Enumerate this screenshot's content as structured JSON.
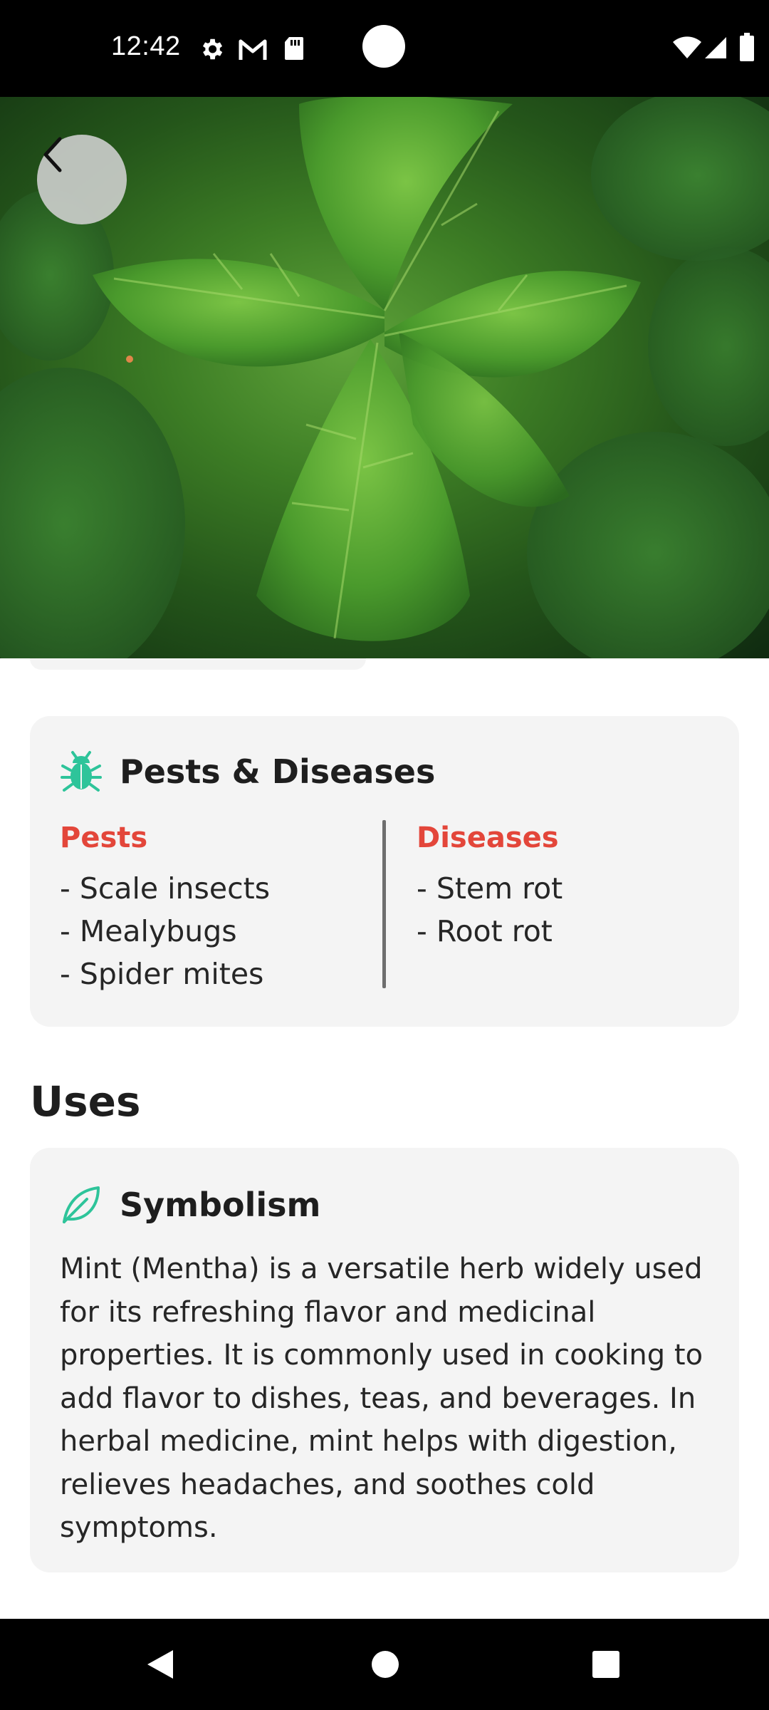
{
  "status_bar": {
    "time": "12:42",
    "icons": [
      "gear-icon",
      "gmail-icon",
      "sd-card-icon",
      "wifi-icon",
      "signal-icon",
      "battery-icon"
    ]
  },
  "hero": {
    "image": "nettle-leaves-photo",
    "back_icon": "chevron-left-icon"
  },
  "pests_card": {
    "icon": "bug-icon",
    "title": "Pests & Diseases",
    "pests_label": "Pests",
    "pests": [
      "- Scale insects",
      "- Mealybugs",
      "- Spider mites"
    ],
    "diseases_label": "Diseases",
    "diseases": [
      "- Stem rot",
      "- Root rot"
    ]
  },
  "uses": {
    "section_title": "Uses",
    "card_icon": "leaf-icon",
    "card_title": "Symbolism",
    "text": "Mint (Mentha) is a versatile herb widely used for its refreshing flavor and medicinal properties. It is commonly used in cooking to add flavor to dishes, teas, and beverages. In herbal medicine, mint helps with digestion, relieves headaches, and soothes cold symptoms."
  },
  "colors": {
    "accent_green": "#2ec49a",
    "label_red": "#e3463a",
    "card_bg": "#f4f4f4"
  },
  "nav_bar": {
    "icons": [
      "back-triangle-icon",
      "home-circle-icon",
      "recents-square-icon"
    ]
  }
}
